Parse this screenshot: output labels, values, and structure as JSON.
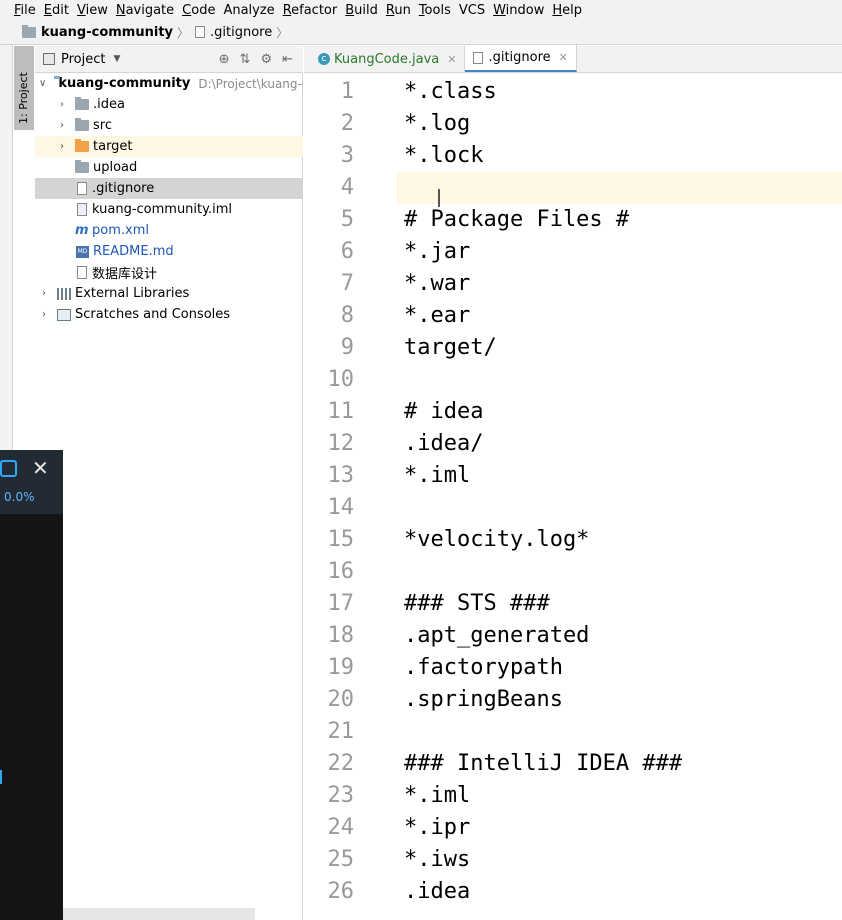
{
  "menu": [
    {
      "label": "File",
      "mn": "F",
      "rest": "ile"
    },
    {
      "label": "Edit",
      "mn": "E",
      "rest": "dit"
    },
    {
      "label": "View",
      "mn": "V",
      "rest": "iew"
    },
    {
      "label": "Navigate",
      "mn": "N",
      "rest": "avigate"
    },
    {
      "label": "Code",
      "mn": "C",
      "rest": "ode"
    },
    {
      "label": "Analyze",
      "mn": "",
      "rest": "Analyze"
    },
    {
      "label": "Refactor",
      "mn": "R",
      "rest": "efactor"
    },
    {
      "label": "Build",
      "mn": "B",
      "rest": "uild"
    },
    {
      "label": "Run",
      "mn": "R",
      "rest": "un"
    },
    {
      "label": "Tools",
      "mn": "T",
      "rest": "ools"
    },
    {
      "label": "VCS",
      "mn": "",
      "rest": "VCS"
    },
    {
      "label": "Window",
      "mn": "W",
      "rest": "indow"
    },
    {
      "label": "Help",
      "mn": "H",
      "rest": "elp"
    }
  ],
  "breadcrumb": {
    "project": "kuang-community",
    "file": ".gitignore"
  },
  "tool_window": {
    "stripe_label": "1: Project",
    "header_title": "Project"
  },
  "tree": {
    "root_name": "kuang-community",
    "root_path": "D:\\Project\\kuang-c",
    "items": [
      {
        "label": ".idea"
      },
      {
        "label": "src"
      },
      {
        "label": "target"
      },
      {
        "label": "upload"
      },
      {
        "label": ".gitignore"
      },
      {
        "label": "kuang-community.iml"
      },
      {
        "label": "pom.xml"
      },
      {
        "label": "README.md"
      },
      {
        "label": "数据库设计"
      },
      {
        "label": "External Libraries"
      },
      {
        "label": "Scratches and Consoles"
      }
    ]
  },
  "tabs": [
    {
      "label": "KuangCode.java",
      "active": false
    },
    {
      "label": ".gitignore",
      "active": true
    }
  ],
  "editor": {
    "lines": [
      {
        "n": "1",
        "text": "*.class"
      },
      {
        "n": "2",
        "text": "*.log"
      },
      {
        "n": "3",
        "text": "*.lock"
      },
      {
        "n": "4",
        "text": ""
      },
      {
        "n": "5",
        "text": "# Package Files #"
      },
      {
        "n": "6",
        "text": "*.jar"
      },
      {
        "n": "7",
        "text": "*.war"
      },
      {
        "n": "8",
        "text": "*.ear"
      },
      {
        "n": "9",
        "text": "target/"
      },
      {
        "n": "10",
        "text": ""
      },
      {
        "n": "11",
        "text": "# idea"
      },
      {
        "n": "12",
        "text": ".idea/"
      },
      {
        "n": "13",
        "text": "*.iml"
      },
      {
        "n": "14",
        "text": ""
      },
      {
        "n": "15",
        "text": "*velocity.log*"
      },
      {
        "n": "16",
        "text": ""
      },
      {
        "n": "17",
        "text": "### STS ###"
      },
      {
        "n": "18",
        "text": ".apt_generated"
      },
      {
        "n": "19",
        "text": ".factorypath"
      },
      {
        "n": "20",
        "text": ".springBeans"
      },
      {
        "n": "21",
        "text": ""
      },
      {
        "n": "22",
        "text": "### IntelliJ IDEA ###"
      },
      {
        "n": "23",
        "text": "*.iml"
      },
      {
        "n": "24",
        "text": "*.ipr"
      },
      {
        "n": "25",
        "text": "*.iws"
      },
      {
        "n": "26",
        "text": ".idea"
      }
    ]
  },
  "overlay": {
    "percent": "0.0%"
  }
}
